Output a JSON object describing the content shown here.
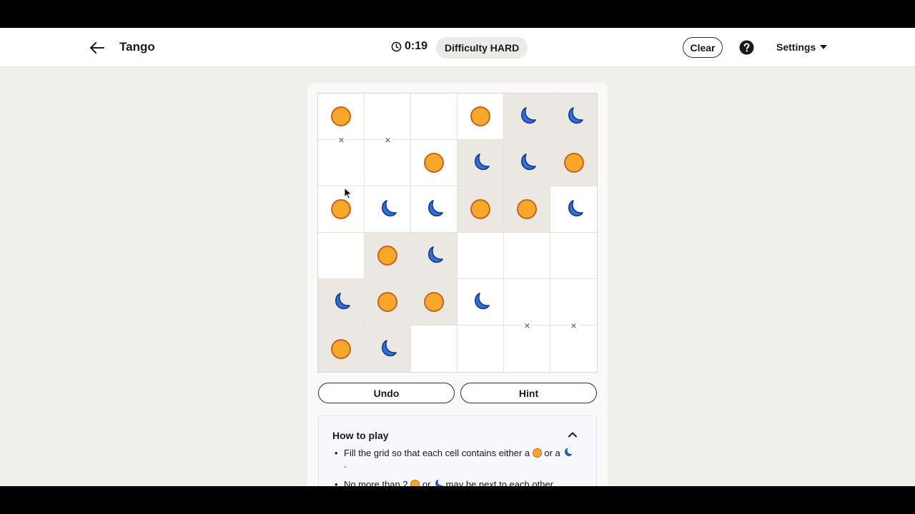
{
  "header": {
    "title": "Tango",
    "timer": "0:19",
    "difficulty": "Difficulty HARD",
    "clear_label": "Clear",
    "settings_label": "Settings"
  },
  "board": {
    "rows": [
      [
        "sun",
        "empty",
        "empty",
        "sun",
        "moon",
        "moon"
      ],
      [
        "empty",
        "empty",
        "sun",
        "moon",
        "moon",
        "sun"
      ],
      [
        "sun",
        "moon",
        "moon",
        "sun",
        "sun",
        "moon"
      ],
      [
        "empty",
        "sun",
        "moon",
        "empty",
        "empty",
        "empty"
      ],
      [
        "moon",
        "sun",
        "sun",
        "moon",
        "empty",
        "empty"
      ],
      [
        "sun",
        "moon",
        "empty",
        "empty",
        "empty",
        "empty"
      ]
    ],
    "locked": [
      [
        false,
        false,
        false,
        false,
        true,
        true
      ],
      [
        false,
        false,
        false,
        true,
        true,
        true
      ],
      [
        false,
        false,
        false,
        true,
        true,
        false
      ],
      [
        false,
        true,
        true,
        false,
        false,
        false
      ],
      [
        true,
        true,
        true,
        false,
        false,
        false
      ],
      [
        true,
        true,
        false,
        false,
        false,
        false
      ]
    ],
    "constraints": [
      {
        "between": [
          [
            0,
            0
          ],
          [
            1,
            0
          ]
        ],
        "symbol": "×"
      },
      {
        "between": [
          [
            0,
            1
          ],
          [
            1,
            1
          ]
        ],
        "symbol": "×"
      },
      {
        "between": [
          [
            4,
            4
          ],
          [
            5,
            4
          ]
        ],
        "symbol": "×"
      },
      {
        "between": [
          [
            4,
            5
          ],
          [
            5,
            5
          ]
        ],
        "symbol": "×"
      }
    ]
  },
  "actions": {
    "undo_label": "Undo",
    "hint_label": "Hint"
  },
  "how_to_play": {
    "title": "How to play",
    "rule1_before": "Fill the grid so that each cell contains either a",
    "rule1_mid": "or a",
    "rule1_end": ".",
    "rule2_before": "No more than 2",
    "rule2_mid": "or",
    "rule2_end": "may be next to each other"
  },
  "colors": {
    "sun_fill": "#f7a72a",
    "sun_stroke": "#c7641f",
    "moon_fill": "#2f6fdc",
    "moon_stroke": "#1d3f8f",
    "locked_cell": "#ebe8e4"
  },
  "icons": {
    "back": "arrow-left-icon",
    "timer": "clock-icon",
    "help": "question-circle-icon",
    "settings_caret": "caret-down-icon",
    "collapse": "chevron-up-icon"
  }
}
